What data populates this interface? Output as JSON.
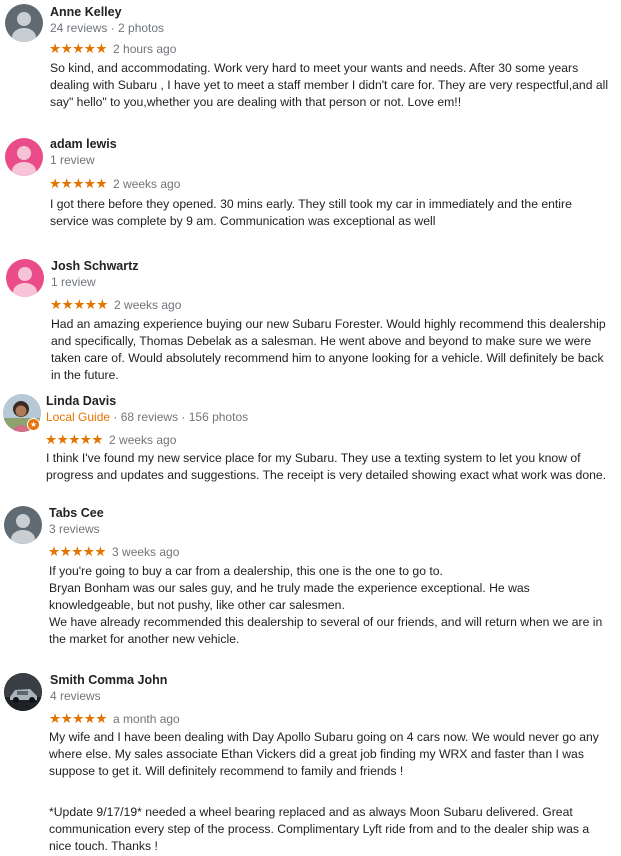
{
  "colors": {
    "star": "#e37400",
    "meta_gray": "#70757a",
    "local_guide": "#e37400",
    "avatar_gray": "#5f6a73",
    "avatar_pink": "#ea4c89"
  },
  "reviews": [
    {
      "name": "Anne Kelley",
      "meta": "24 reviews · 2 photos",
      "stars": "★★★★★",
      "rating": 5,
      "time": "2 hours ago",
      "avatar_icon": "person-silhouette-icon",
      "text": [
        "So kind, and accommodating. Work very hard to meet your wants and needs. After 30 some years",
        "dealing with Subaru , I have yet to meet a staff member I didn't  care for. They are  very respectful,and all",
        "say\" hello\" to  you,whether you are dealing with that person or not. Love em!!"
      ]
    },
    {
      "name": "adam lewis",
      "meta": "1 review",
      "stars": "★★★★★",
      "rating": 5,
      "time": "2 weeks ago",
      "avatar_icon": "person-silhouette-icon",
      "text": [
        "I got there before they opened.  30 mins early.  They still took my car in immediately and the entire",
        "service was complete by 9 am.  Communication was exceptional as well"
      ]
    },
    {
      "name": "Josh Schwartz",
      "meta": "1 review",
      "stars": "★★★★★",
      "rating": 5,
      "time": "2 weeks ago",
      "avatar_icon": "person-silhouette-icon",
      "text": [
        "Had an amazing experience buying our new Subaru Forester. Would highly recommend this dealership",
        "and specifically, Thomas Debelak as a salesman. He went above and beyond to make sure we were",
        "taken care of. Would absolutely recommend him to anyone looking for a vehicle. Will definitely be back",
        "in the future."
      ]
    },
    {
      "name": "Linda Davis",
      "local_guide": "Local Guide",
      "meta": " · 68 reviews · 156 photos",
      "stars": "★★★★★",
      "rating": 5,
      "time": "2 weeks ago",
      "avatar_icon": "profile-photo-icon",
      "badge_icon": "local-guide-star-icon",
      "text": [
        "I think I've found my new service place for my Subaru.  They use a texting system to let you know of",
        "progress and updates and suggestions.  The receipt is very detailed showing exact what work was done."
      ]
    },
    {
      "name": "Tabs Cee",
      "meta": "3 reviews",
      "stars": "★★★★★",
      "rating": 5,
      "time": "3 weeks ago",
      "avatar_icon": "person-silhouette-icon",
      "text": [
        "If you're going to buy a car from a dealership, this one is the one to go to.",
        "Bryan Bonham was our sales guy, and he truly made the experience exceptional. He was",
        "knowledgeable, but not pushy, like other car salesmen.",
        "We have already recommended this dealership to several of our friends, and will return when we are in",
        "the market for another new vehicle."
      ]
    },
    {
      "name": "Smith Comma John",
      "meta": "4 reviews",
      "stars": "★★★★★",
      "rating": 5,
      "time": "a month ago",
      "avatar_icon": "car-photo-icon",
      "text": [
        "My wife and I have been dealing with Day Apollo Subaru going on 4 cars now. We would never go any",
        "where else. My sales associate Ethan Vickers  did a great job finding my WRX and faster than I was",
        "suppose to get it. Will definitely recommend to family and friends !",
        "",
        "*Update 9/17/19* needed a wheel bearing replaced and as always Moon Subaru delivered. Great",
        "communication every step of the process. Complimentary Lyft ride from and to the dealer ship was a",
        "nice touch. Thanks !"
      ]
    }
  ]
}
